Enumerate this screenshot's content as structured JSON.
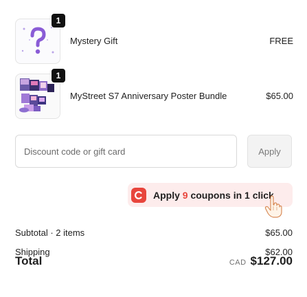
{
  "line_items": [
    {
      "quantity": "1",
      "name": "Mystery Gift",
      "price": "FREE",
      "thumbnail_icon": "question-mark-icon"
    },
    {
      "quantity": "1",
      "name": "MyStreet S7 Anniversary Poster Bundle",
      "price": "$65.00",
      "thumbnail_icon": "poster-bundle-image"
    }
  ],
  "discount": {
    "placeholder": "Discount code or gift card",
    "value": "",
    "apply_label": "Apply"
  },
  "coupons": {
    "prefix": "Apply",
    "count": "9",
    "suffix": "coupons in 1 click",
    "logo_icon": "coupon-extension-logo-icon",
    "accent_color": "#e8453c",
    "background_color": "#fdecec"
  },
  "summary": {
    "subtotal_label": "Subtotal · 2 items",
    "subtotal_value": "$65.00",
    "shipping_label": "Shipping",
    "shipping_value": "$62.00",
    "total_label": "Total",
    "currency": "CAD",
    "total_value": "$127.00"
  }
}
